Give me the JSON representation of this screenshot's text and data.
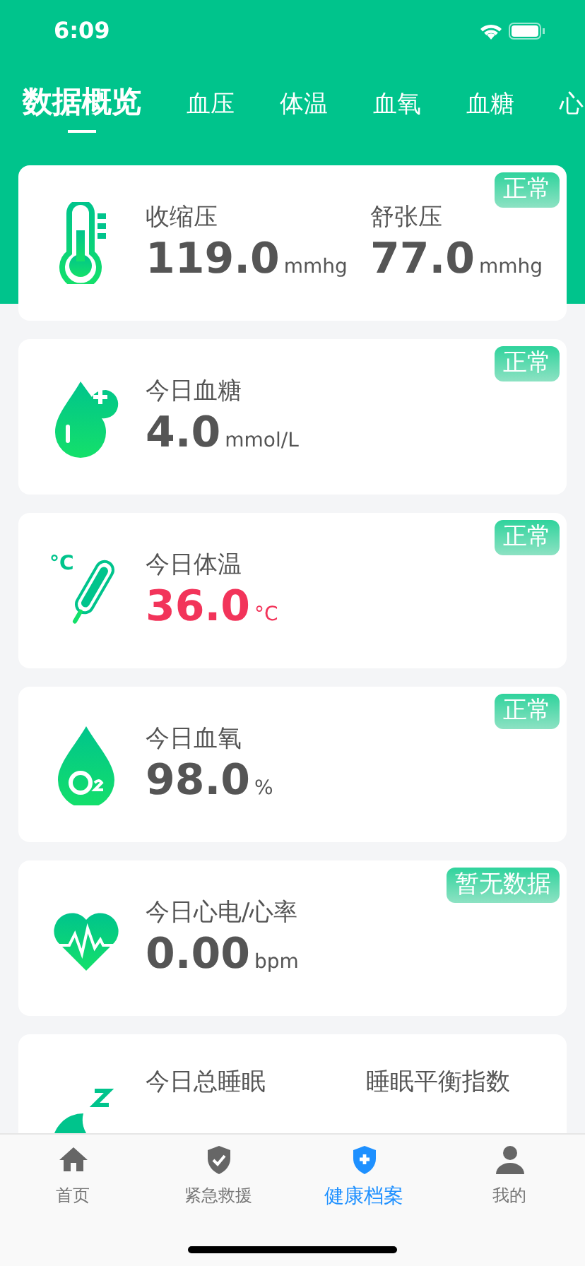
{
  "status_bar": {
    "time": "6:09"
  },
  "tabs": [
    {
      "label": "数据概览",
      "selected": true
    },
    {
      "label": "血压",
      "selected": false
    },
    {
      "label": "体温",
      "selected": false
    },
    {
      "label": "血氧",
      "selected": false
    },
    {
      "label": "血糖",
      "selected": false
    },
    {
      "label": "心",
      "selected": false
    }
  ],
  "cards": [
    {
      "kind": "pressure",
      "badge": "正常",
      "readings": [
        {
          "label": "收缩压",
          "value": "119.0",
          "unit": "mmhg"
        },
        {
          "label": "舒张压",
          "value": "77.0",
          "unit": "mmhg"
        }
      ],
      "highlight": false
    },
    {
      "kind": "glucose",
      "badge": "正常",
      "readings": [
        {
          "label": "今日血糖",
          "value": "4.0",
          "unit": "mmol/L"
        }
      ],
      "highlight": false
    },
    {
      "kind": "temperature",
      "icon_text": "°C",
      "badge": "正常",
      "readings": [
        {
          "label": "今日体温",
          "value": "36.0",
          "unit": "°C"
        }
      ],
      "highlight": true
    },
    {
      "kind": "oxygen",
      "badge": "正常",
      "readings": [
        {
          "label": "今日血氧",
          "value": "98.0",
          "unit": "%"
        }
      ],
      "highlight": false
    },
    {
      "kind": "heart",
      "badge": "暂无数据",
      "readings": [
        {
          "label": "今日心电/心率",
          "value": "0.00",
          "unit": "bpm"
        }
      ],
      "highlight": false
    },
    {
      "kind": "sleep",
      "title": "今日总睡眠",
      "side_label": "睡眠平衡指数"
    }
  ],
  "bottom_nav": [
    {
      "kind": "home",
      "label": "首页",
      "selected": false
    },
    {
      "kind": "rescue",
      "label": "紧急救援",
      "selected": false
    },
    {
      "kind": "record",
      "label": "健康档案",
      "selected": true
    },
    {
      "kind": "me",
      "label": "我的",
      "selected": false
    }
  ]
}
